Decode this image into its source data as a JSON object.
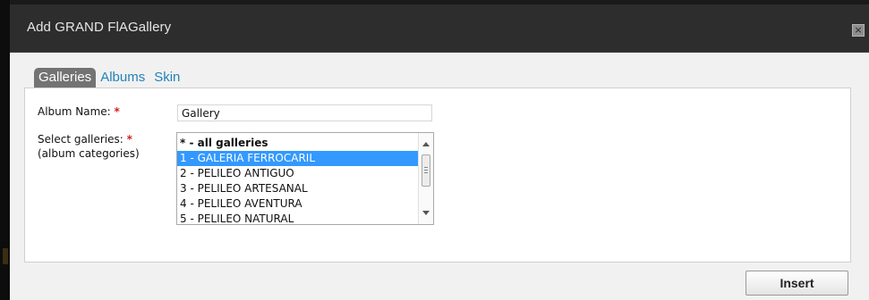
{
  "window": {
    "title": "Add GRAND FlAGallery",
    "close_glyph": "×"
  },
  "tabs": [
    {
      "label": "Galleries",
      "active": true
    },
    {
      "label": "Albums",
      "active": false
    },
    {
      "label": "Skin",
      "active": false
    }
  ],
  "form": {
    "album_name_label": "Album Name:",
    "album_name_value": "Gallery",
    "select_galleries_label": "Select galleries:",
    "select_galleries_sublabel": "(album categories)",
    "required_marker": "*"
  },
  "galleries_list": {
    "selected_index": 1,
    "options": [
      "* - all galleries",
      "1 - GALERIA FERROCARIL",
      "2 - PELILEO ANTIGUO",
      "3 - PELILEO ARTESANAL",
      "4 - PELILEO AVENTURA",
      "5 - PELILEO NATURAL"
    ]
  },
  "buttons": {
    "insert_label": "Insert"
  },
  "colors": {
    "tab_link": "#2283b7",
    "tab_active_bg": "#737373",
    "selection": "#3399ff",
    "required": "#d21f1f"
  }
}
